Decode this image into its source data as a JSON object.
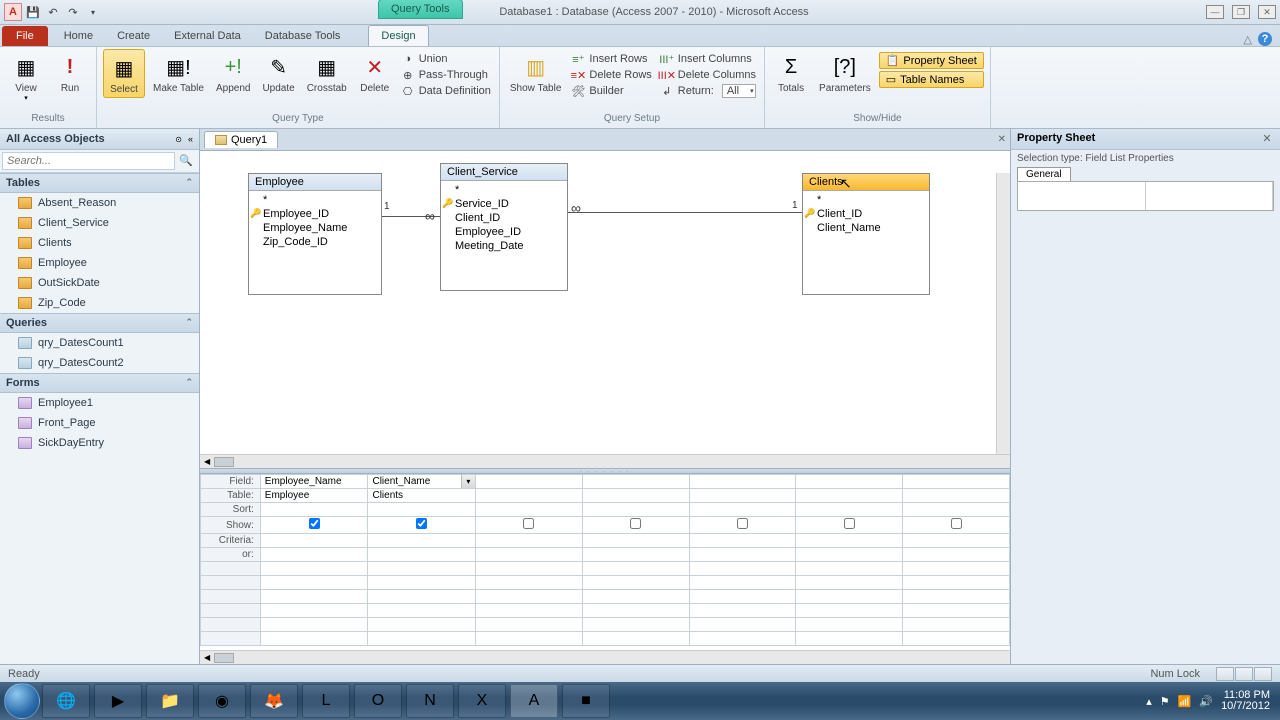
{
  "app": {
    "title": "Database1 : Database (Access 2007 - 2010)  -  Microsoft Access",
    "contextTab": "Query Tools"
  },
  "tabs": {
    "file": "File",
    "home": "Home",
    "create": "Create",
    "externalData": "External Data",
    "databaseTools": "Database Tools",
    "design": "Design"
  },
  "ribbon": {
    "results": {
      "view": "View",
      "run": "Run",
      "label": "Results"
    },
    "queryType": {
      "select": "Select",
      "makeTable": "Make\nTable",
      "append": "Append",
      "update": "Update",
      "crosstab": "Crosstab",
      "delete": "Delete",
      "union": "Union",
      "passThrough": "Pass-Through",
      "dataDef": "Data Definition",
      "label": "Query Type"
    },
    "querySetup": {
      "showTable": "Show\nTable",
      "insertRows": "Insert Rows",
      "deleteRows": "Delete Rows",
      "builder": "Builder",
      "insertColumns": "Insert Columns",
      "deleteColumns": "Delete Columns",
      "return": "Return:",
      "returnVal": "All",
      "label": "Query Setup"
    },
    "showHide": {
      "totals": "Totals",
      "parameters": "Parameters",
      "propertySheet": "Property Sheet",
      "tableNames": "Table Names",
      "label": "Show/Hide"
    }
  },
  "nav": {
    "title": "All Access Objects",
    "searchPlaceholder": "Search...",
    "sections": {
      "tables": "Tables",
      "queries": "Queries",
      "forms": "Forms"
    },
    "tables": [
      "Absent_Reason",
      "Client_Service",
      "Clients",
      "Employee",
      "OutSickDate",
      "Zip_Code"
    ],
    "queries": [
      "qry_DatesCount1",
      "qry_DatesCount2"
    ],
    "forms": [
      "Employee1",
      "Front_Page",
      "SickDayEntry"
    ]
  },
  "query": {
    "tabName": "Query1",
    "tables": {
      "employee": {
        "title": "Employee",
        "fields": [
          "*",
          "Employee_ID",
          "Employee_Name",
          "Zip_Code_ID"
        ],
        "pk": [
          1
        ]
      },
      "clientService": {
        "title": "Client_Service",
        "fields": [
          "*",
          "Service_ID",
          "Client_ID",
          "Employee_ID",
          "Meeting_Date"
        ],
        "pk": [
          1
        ]
      },
      "clients": {
        "title": "Clients",
        "fields": [
          "*",
          "Client_ID",
          "Client_Name"
        ],
        "pk": [
          1
        ]
      }
    },
    "rel": {
      "one": "1",
      "many": "∞"
    }
  },
  "qbe": {
    "rowLabels": {
      "field": "Field:",
      "table": "Table:",
      "sort": "Sort:",
      "show": "Show:",
      "criteria": "Criteria:",
      "or": "or:"
    },
    "cols": [
      {
        "field": "Employee_Name",
        "table": "Employee",
        "show": true
      },
      {
        "field": "Client_Name",
        "table": "Clients",
        "show": true
      },
      {
        "field": "",
        "table": "",
        "show": false
      },
      {
        "field": "",
        "table": "",
        "show": false
      },
      {
        "field": "",
        "table": "",
        "show": false
      },
      {
        "field": "",
        "table": "",
        "show": false
      },
      {
        "field": "",
        "table": "",
        "show": false
      }
    ]
  },
  "propSheet": {
    "title": "Property Sheet",
    "selType": "Selection type:  Field List Properties",
    "tab": "General"
  },
  "status": {
    "ready": "Ready",
    "numLock": "Num Lock"
  },
  "taskbar": {
    "tray": {
      "time": "11:08 PM",
      "date": "10/7/2012"
    }
  }
}
